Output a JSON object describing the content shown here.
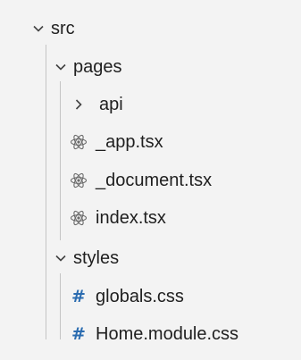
{
  "tree": {
    "src": {
      "label": "src",
      "icon": "chevron-down-icon",
      "expanded": true
    },
    "pages": {
      "label": "pages",
      "icon": "chevron-down-icon",
      "expanded": true,
      "items": [
        {
          "label": "api",
          "icon": "chevron-right-icon",
          "kind": "folder",
          "expanded": false
        },
        {
          "label": "_app.tsx",
          "icon": "react-icon",
          "kind": "file"
        },
        {
          "label": "_document.tsx",
          "icon": "react-icon",
          "kind": "file"
        },
        {
          "label": "index.tsx",
          "icon": "react-icon",
          "kind": "file"
        }
      ]
    },
    "styles": {
      "label": "styles",
      "icon": "chevron-down-icon",
      "expanded": true,
      "items": [
        {
          "label": "globals.css",
          "icon": "hash-icon",
          "kind": "file"
        },
        {
          "label": "Home.module.css",
          "icon": "hash-icon",
          "kind": "file"
        }
      ]
    }
  },
  "colors": {
    "background": "#f3f3f3",
    "text": "#1f1f1f",
    "css_icon": "#2b6cb0",
    "react_icon": "#6b6b6b",
    "indent_guide": "#c4c4c4"
  }
}
